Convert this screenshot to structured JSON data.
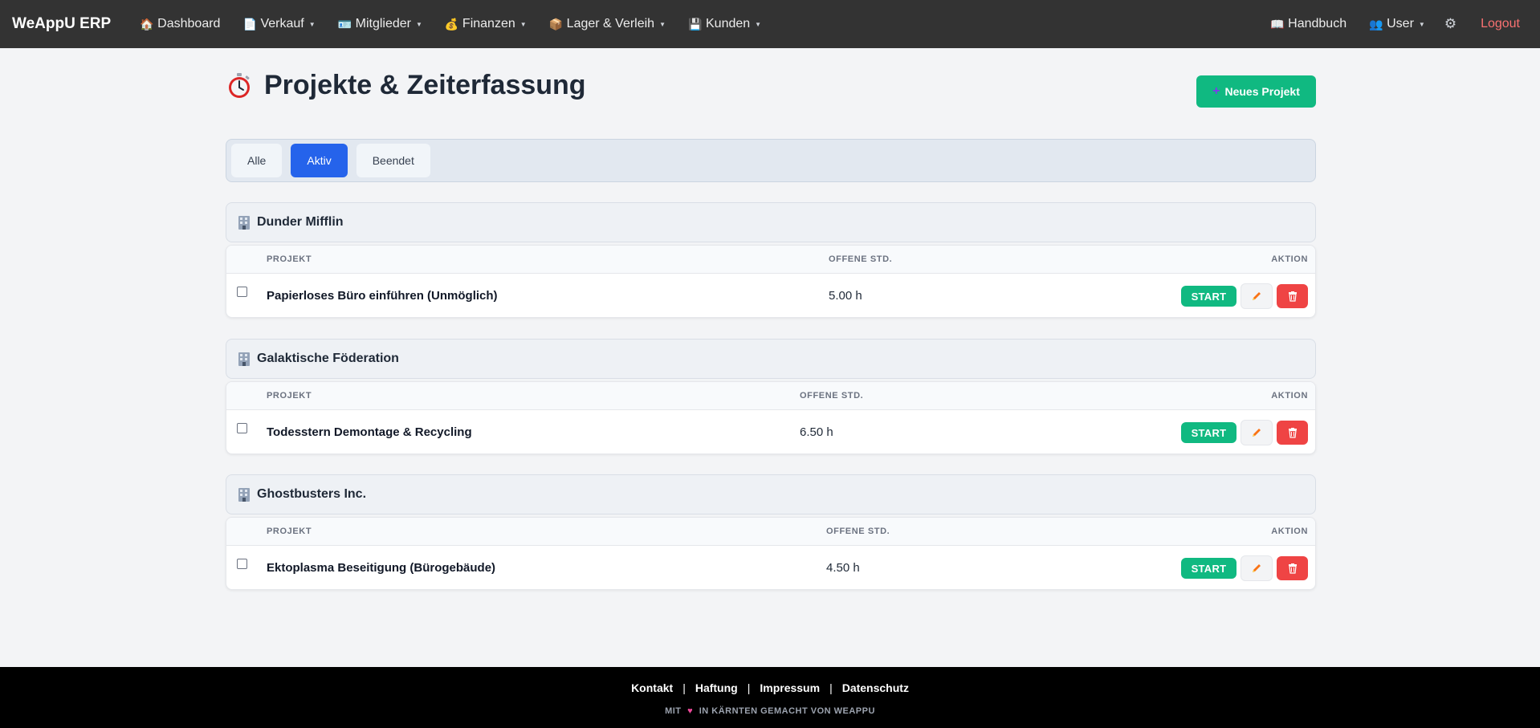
{
  "navbar": {
    "brand": "WeAppU ERP",
    "items": [
      {
        "label": "Dashboard",
        "icon": "house-icon",
        "dropdown": false
      },
      {
        "label": "Verkauf",
        "icon": "document-icon",
        "dropdown": true
      },
      {
        "label": "Mitglieder",
        "icon": "id-card-icon",
        "dropdown": true
      },
      {
        "label": "Finanzen",
        "icon": "money-bag-icon",
        "dropdown": true
      },
      {
        "label": "Lager & Verleih",
        "icon": "package-icon",
        "dropdown": true
      },
      {
        "label": "Kunden",
        "icon": "floppy-disk-icon",
        "dropdown": true
      }
    ],
    "right": {
      "handbook": "Handbuch",
      "user": "User",
      "logout": "Logout"
    }
  },
  "page": {
    "title": "Projekte & Zeiterfassung",
    "new_project_label": "Neues Projekt"
  },
  "filters": {
    "options": [
      "Alle",
      "Aktiv",
      "Beendet"
    ],
    "active": "Aktiv"
  },
  "table_headers": {
    "project": "PROJEKT",
    "open_hours": "OFFENE STD.",
    "action": "AKTION"
  },
  "groups": [
    {
      "client": "Dunder Mifflin",
      "projects": [
        {
          "name": "Papierloses Büro einführen (Unmöglich)",
          "hours": "5.00 h"
        }
      ]
    },
    {
      "client": "Galaktische Föderation",
      "projects": [
        {
          "name": "Todesstern Demontage & Recycling",
          "hours": "6.50 h"
        }
      ]
    },
    {
      "client": "Ghostbusters Inc.",
      "projects": [
        {
          "name": "Ektoplasma Beseitigung (Bürogebäude)",
          "hours": "4.50 h"
        }
      ]
    }
  ],
  "row_actions": {
    "start_label": "START"
  },
  "footer": {
    "links": [
      "Kontakt",
      "Haftung",
      "Impressum",
      "Datenschutz"
    ],
    "note_before": "MIT",
    "note_after": "IN KÄRNTEN GEMACHT VON WEAPPU"
  },
  "colors": {
    "navbar": "#333333",
    "accent_green": "#10b981",
    "active_blue": "#2563eb",
    "danger_red": "#ef4444",
    "logout": "#f87171"
  }
}
